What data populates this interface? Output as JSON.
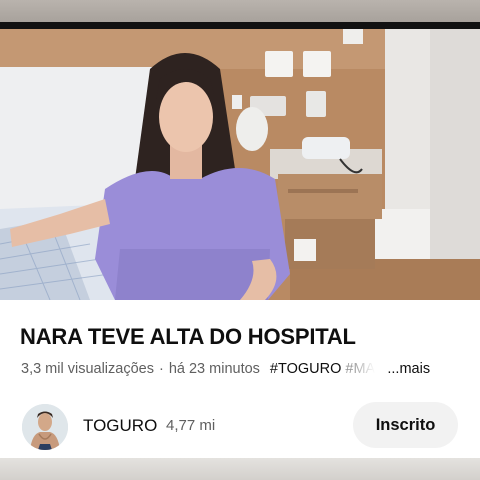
{
  "video": {
    "title": "NARA TEVE ALTA DO HOSPITAL",
    "views": "3,3 mil visualizações",
    "separator": "·",
    "posted": "há 23 minutos",
    "hashtags": [
      "#TOGURO",
      "#MA"
    ],
    "more_label": "...mais"
  },
  "channel": {
    "name": "TOGURO",
    "subscribers": "4,77 mi",
    "subscribe_label": "Inscrito"
  },
  "colors": {
    "text_primary": "#0f0f0f",
    "text_secondary": "#606060",
    "button_bg": "#f2f2f2"
  },
  "icons": {
    "avatar": "channel-avatar-image",
    "thumbnail": "video-thumbnail-image"
  }
}
